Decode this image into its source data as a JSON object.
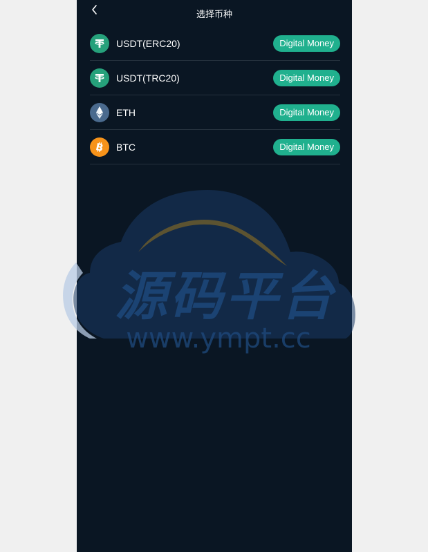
{
  "header": {
    "title": "选择币种"
  },
  "coins": [
    {
      "name": "USDT(ERC20)",
      "tag": "Digital Money",
      "icon": "tether-icon",
      "color": "#26a17b"
    },
    {
      "name": "USDT(TRC20)",
      "tag": "Digital Money",
      "icon": "tether-icon",
      "color": "#26a17b"
    },
    {
      "name": "ETH",
      "tag": "Digital Money",
      "icon": "ethereum-icon",
      "color": "#4a6a8e"
    },
    {
      "name": "BTC",
      "tag": "Digital Money",
      "icon": "bitcoin-icon",
      "color": "#f7931a"
    }
  ],
  "watermark": {
    "title": "源码平台",
    "url": "www.ympt.cc"
  },
  "colors": {
    "background": "#0a1623",
    "tag": "#20b08e",
    "outer": "#f0f0f0"
  }
}
